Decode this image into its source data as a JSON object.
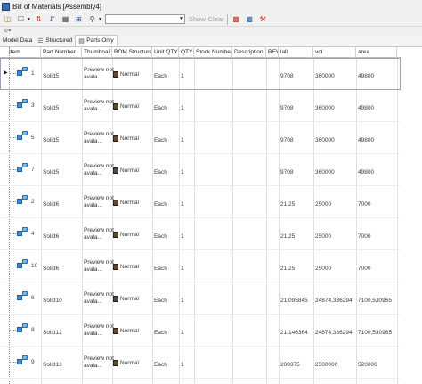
{
  "window": {
    "title": "Bill of Materials [Assembly4]"
  },
  "toolbar": {
    "buttons": [
      {
        "name": "bom-icon"
      },
      {
        "name": "open-icon"
      },
      {
        "name": "dropdown-arrow-icon"
      },
      {
        "name": "filter-icon"
      },
      {
        "name": "sort-icon"
      },
      {
        "name": "structure-icon"
      },
      {
        "name": "expand-icon"
      },
      {
        "name": "find-icon"
      },
      {
        "name": "dropdown-arrow-icon"
      }
    ],
    "search_value": "",
    "show_label": "Show",
    "clear_label": "Clear",
    "right_buttons": [
      {
        "name": "export-icon"
      },
      {
        "name": "import-icon"
      },
      {
        "name": "settings-icon"
      }
    ]
  },
  "tabs": [
    {
      "label": "Model Data",
      "active": false
    },
    {
      "label": "Structured",
      "active": false
    },
    {
      "label": "Parts Only",
      "active": true
    }
  ],
  "columns": [
    {
      "key": "item",
      "label": "Item"
    },
    {
      "key": "part_number",
      "label": "Part Number"
    },
    {
      "key": "thumbnail",
      "label": "Thumbnail"
    },
    {
      "key": "bom_structure",
      "label": "BOM Structure"
    },
    {
      "key": "unit_qty",
      "label": "Unit QTY"
    },
    {
      "key": "qty",
      "label": "QTY"
    },
    {
      "key": "stock_number",
      "label": "Stock Number"
    },
    {
      "key": "description",
      "label": "Description"
    },
    {
      "key": "rev",
      "label": "REV"
    },
    {
      "key": "lall",
      "label": "lall"
    },
    {
      "key": "vol",
      "label": "vol"
    },
    {
      "key": "area",
      "label": "area"
    }
  ],
  "rows": [
    {
      "item": "1",
      "part_number": "Solid5",
      "thumbnail": "Preview not avala...",
      "bom_structure": "Normal",
      "unit_qty": "Each",
      "qty": "1",
      "lall": "9708",
      "vol": "360000",
      "area": "49800",
      "selected": true
    },
    {
      "item": "3",
      "part_number": "Solid5",
      "thumbnail": "Preview not avala...",
      "bom_structure": "Normal",
      "unit_qty": "Each",
      "qty": "1",
      "lall": "9708",
      "vol": "360000",
      "area": "49800"
    },
    {
      "item": "5",
      "part_number": "Solid5",
      "thumbnail": "Preview not avala...",
      "bom_structure": "Normal",
      "unit_qty": "Each",
      "qty": "1",
      "lall": "9708",
      "vol": "360000",
      "area": "49800"
    },
    {
      "item": "7",
      "part_number": "Solid5",
      "thumbnail": "Preview not avala...",
      "bom_structure": "Normal",
      "unit_qty": "Each",
      "qty": "1",
      "lall": "9708",
      "vol": "360000",
      "area": "49800"
    },
    {
      "item": "2",
      "part_number": "Solid6",
      "thumbnail": "Preview not avala...",
      "bom_structure": "Normal",
      "unit_qty": "Each",
      "qty": "1",
      "lall": "21,25",
      "vol": "25000",
      "area": "7000"
    },
    {
      "item": "4",
      "part_number": "Solid6",
      "thumbnail": "Preview not avala...",
      "bom_structure": "Normal",
      "unit_qty": "Each",
      "qty": "1",
      "lall": "21,25",
      "vol": "25000",
      "area": "7000"
    },
    {
      "item": "10",
      "part_number": "Solid6",
      "thumbnail": "Preview not avala...",
      "bom_structure": "Normal",
      "unit_qty": "Each",
      "qty": "1",
      "lall": "21,25",
      "vol": "25000",
      "area": "7000"
    },
    {
      "item": "6",
      "part_number": "Solid10",
      "thumbnail": "Preview not avala...",
      "bom_structure": "Normal",
      "unit_qty": "Each",
      "qty": "1",
      "lall": "21,095845",
      "vol": "24874,336294",
      "area": "7100,530965"
    },
    {
      "item": "8",
      "part_number": "Solid12",
      "thumbnail": "Preview not avala...",
      "bom_structure": "Normal",
      "unit_qty": "Each",
      "qty": "1",
      "lall": "21,146364",
      "vol": "24874,336294",
      "area": "7100,530965"
    },
    {
      "item": "9",
      "part_number": "Solid13",
      "thumbnail": "Preview not avala...",
      "bom_structure": "Normal",
      "unit_qty": "Each",
      "qty": "1",
      "lall": "208375",
      "vol": "2500000",
      "area": "520000"
    }
  ]
}
